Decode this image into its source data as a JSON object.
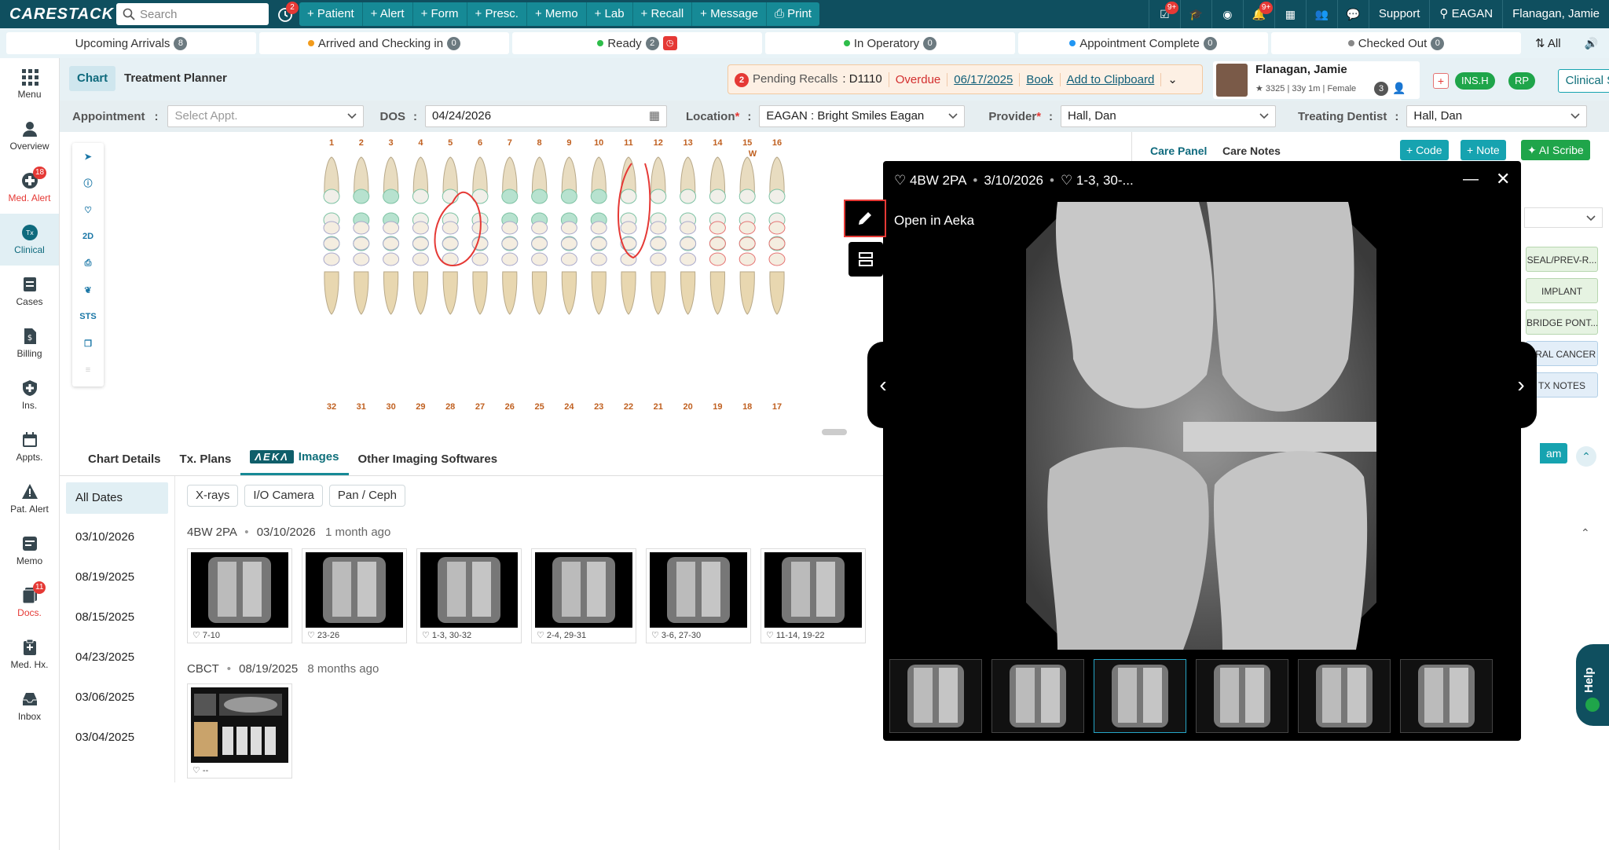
{
  "app": {
    "logo": "CARESTACK",
    "search_placeholder": "Search",
    "history_badge": "2"
  },
  "quick_actions": [
    "+ Patient",
    "+ Alert",
    "+ Form",
    "+ Presc.",
    "+ Memo",
    "+ Lab",
    "+ Recall",
    "+ Message",
    "Print"
  ],
  "top_right": {
    "badge1": "9+",
    "badge2": "9+",
    "support": "Support",
    "location": "EAGAN",
    "user": "Flanagan, Jamie"
  },
  "status": [
    {
      "label": "Upcoming Arrivals",
      "count": "8",
      "color": ""
    },
    {
      "label": "Arrived and Checking in",
      "count": "0",
      "color": "#f29b1b"
    },
    {
      "label": "Ready",
      "count": "2",
      "color": "#2ebd4a"
    },
    {
      "label": "In Operatory",
      "count": "0",
      "color": "#2ebd4a"
    },
    {
      "label": "Appointment Complete",
      "count": "0",
      "color": "#2196f3"
    },
    {
      "label": "Checked Out",
      "count": "0",
      "color": "#888888"
    }
  ],
  "status_all": "All",
  "sidebar": [
    {
      "label": "Menu",
      "icon": "grid-icon",
      "badge": ""
    },
    {
      "label": "Overview",
      "icon": "person-icon",
      "badge": ""
    },
    {
      "label": "Med. Alert",
      "icon": "medical-plus-icon",
      "badge": "18"
    },
    {
      "label": "Clinical",
      "icon": "tx-icon",
      "badge": ""
    },
    {
      "label": "Cases",
      "icon": "cases-icon",
      "badge": ""
    },
    {
      "label": "Billing",
      "icon": "billing-icon",
      "badge": ""
    },
    {
      "label": "Ins.",
      "icon": "shield-icon",
      "badge": ""
    },
    {
      "label": "Appts.",
      "icon": "calendar-icon",
      "badge": ""
    },
    {
      "label": "Pat. Alert",
      "icon": "warning-icon",
      "badge": ""
    },
    {
      "label": "Memo",
      "icon": "memo-icon",
      "badge": ""
    },
    {
      "label": "Docs.",
      "icon": "docs-icon",
      "badge": "11"
    },
    {
      "label": "Med. Hx.",
      "icon": "clipboard-icon",
      "badge": ""
    },
    {
      "label": "Inbox",
      "icon": "inbox-icon",
      "badge": ""
    }
  ],
  "subheader": {
    "tab_chart": "Chart",
    "tab_planner": "Treatment Planner",
    "recall_count": "2",
    "recall_label": "Pending Recalls",
    "recall_code": ": D1110",
    "overdue": "Overdue",
    "recall_date": "06/17/2025",
    "book": "Book",
    "clipboard": "Add to Clipboard"
  },
  "patient": {
    "name": "Flanagan, Jamie",
    "id": "3325",
    "age": "33y 1m",
    "sex": "Female",
    "count": "3",
    "ins": "INS.H",
    "rp": "RP",
    "plus": "+"
  },
  "clinical_summary": "Clinical Summary",
  "form": {
    "appt_label": "Appointment",
    "appt_placeholder": "Select Appt.",
    "dos_label": "DOS",
    "dos_value": "04/24/2026",
    "loc_label": "Location",
    "loc_value": "EAGAN : Bright Smiles Eagan",
    "prov_label": "Provider",
    "prov_value": "Hall, Dan",
    "treat_label": "Treating Dentist",
    "treat_value": "Hall, Dan",
    "colon": ":",
    "req": "*"
  },
  "tools": [
    "STS",
    "2D"
  ],
  "upper_teeth": [
    "1",
    "2",
    "3",
    "4",
    "5",
    "6",
    "7",
    "8",
    "9",
    "10",
    "11",
    "12",
    "13",
    "14",
    "15",
    "16"
  ],
  "lower_teeth": [
    "32",
    "31",
    "30",
    "29",
    "28",
    "27",
    "26",
    "25",
    "24",
    "23",
    "22",
    "21",
    "20",
    "19",
    "18",
    "17"
  ],
  "tooth13_mark": "W",
  "lower_tabs": {
    "details": "Chart Details",
    "plans": "Tx. Plans",
    "aeka": "ΛΕΚΛ",
    "images": "Images",
    "other": "Other Imaging Softwares"
  },
  "dates": [
    "All Dates",
    "03/10/2026",
    "08/19/2025",
    "08/15/2025",
    "04/23/2025",
    "03/06/2025",
    "03/04/2025"
  ],
  "filters": [
    "X-rays",
    "I/O Camera",
    "Pan / Ceph"
  ],
  "group1": {
    "title": "4BW 2PA",
    "date": "03/10/2026",
    "ago": "1 month ago"
  },
  "group1_thumbs": [
    "7-10",
    "23-26",
    "1-3, 30-32",
    "2-4, 29-31",
    "3-6, 27-30",
    "11-14, 19-22"
  ],
  "group2": {
    "title": "CBCT",
    "date": "08/19/2025",
    "ago": "8 months ago"
  },
  "group2_thumbs": [
    "--"
  ],
  "care": {
    "panel": "Care Panel",
    "notes": "Care Notes",
    "code": "+ Code",
    "note": "+ Note",
    "scribe": "AI Scribe",
    "cam": "am"
  },
  "care_list": [
    "SEAL/PREV-R...",
    "IMPLANT",
    "BRIDGE PONT...",
    "ORAL CANCER",
    "TX NOTES"
  ],
  "viewer": {
    "title": "4BW 2PA",
    "date": "3/10/2026",
    "teeth": "1-3, 30-...",
    "open_aeka": "Open in Aeka",
    "bullet": "•"
  },
  "help": "Help",
  "colors": {
    "topbar": "#0f4f5f",
    "accent": "#168a96",
    "green": "#1fa54a",
    "red": "#e53935"
  }
}
